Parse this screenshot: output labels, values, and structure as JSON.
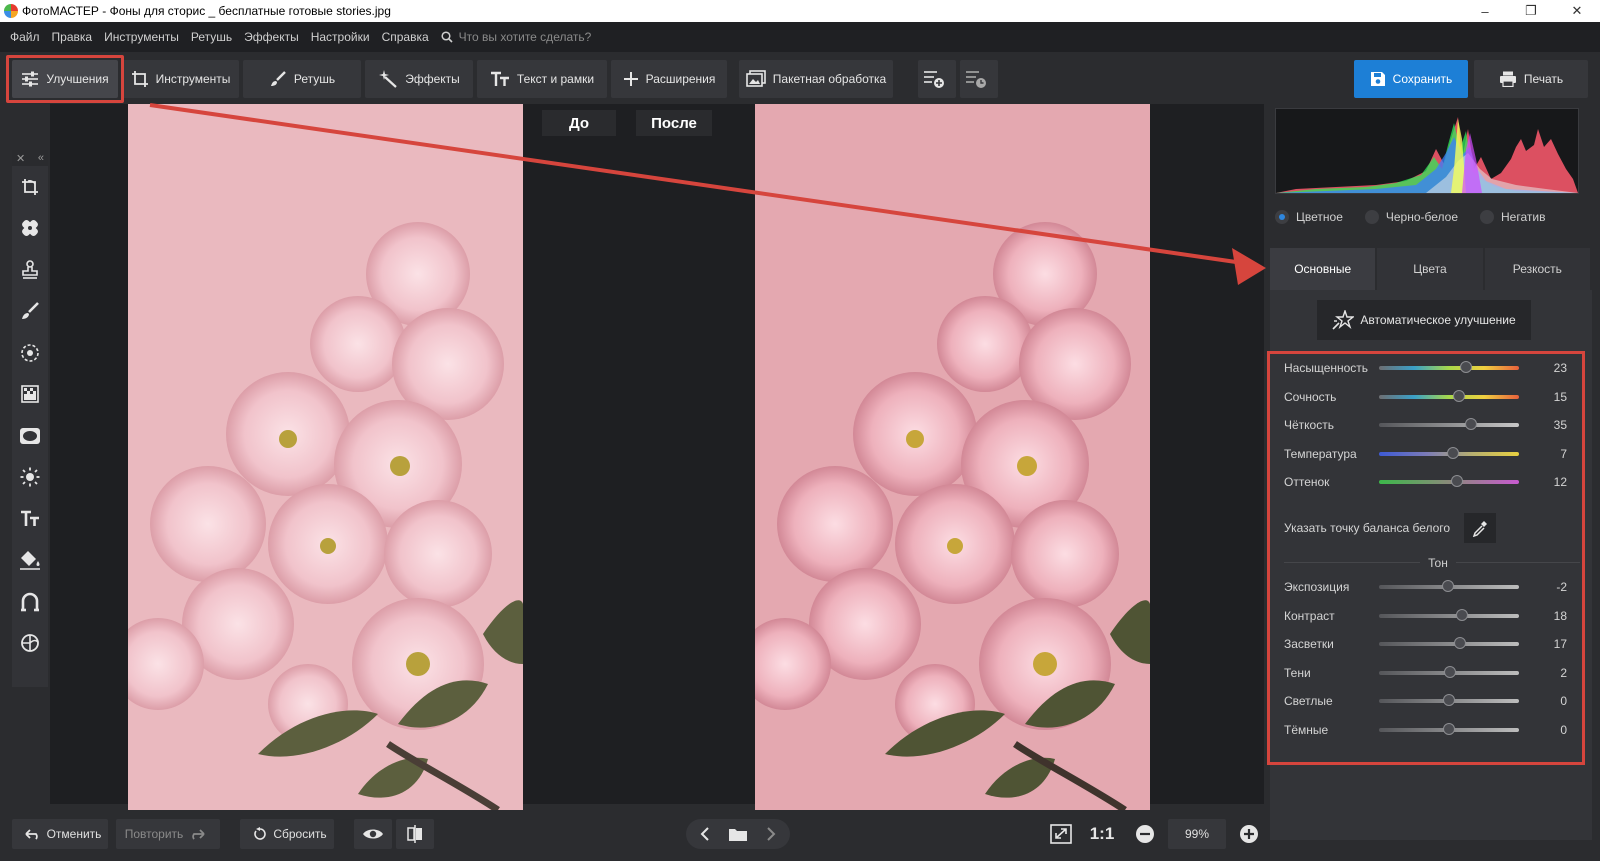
{
  "window": {
    "title": "ФотоМАСТЕР - Фоны для сторис _ бесплатные готовые stories.jpg",
    "minimize": "–",
    "restore": "❐",
    "close": "✕"
  },
  "menu": {
    "items": [
      "Файл",
      "Правка",
      "Инструменты",
      "Ретушь",
      "Эффекты",
      "Настройки",
      "Справка"
    ],
    "search_placeholder": "Что вы хотите сделать?"
  },
  "toolbar": {
    "improvements": "Улучшения",
    "tools": "Инструменты",
    "retouch": "Ретушь",
    "effects": "Эффекты",
    "text_frames": "Текст и рамки",
    "extensions": "Расширения",
    "batch": "Пакетная обработка",
    "save": "Сохранить",
    "print": "Печать"
  },
  "canvas": {
    "before_label": "До",
    "after_label": "После"
  },
  "panel": {
    "modes": [
      {
        "label": "Цветное",
        "selected": true
      },
      {
        "label": "Черно-белое",
        "selected": false
      },
      {
        "label": "Негатив",
        "selected": false
      }
    ],
    "tabs": [
      "Основные",
      "Цвета",
      "Резкость"
    ],
    "active_tab": "Основные",
    "auto_button": "Автоматическое улучшение",
    "color_sliders": [
      {
        "label": "Насыщенность",
        "value": "23",
        "level": 0.62
      },
      {
        "label": "Сочность",
        "value": "15",
        "level": 0.57
      },
      {
        "label": "Чёткость",
        "value": "35",
        "level": 0.66
      },
      {
        "label": "Температура",
        "value": "7",
        "level": 0.53
      },
      {
        "label": "Оттенок",
        "value": "12",
        "level": 0.56
      }
    ],
    "white_balance_label": "Указать точку баланса белого",
    "tone_header": "Тон",
    "tone_sliders": [
      {
        "label": "Экспозиция",
        "value": "-2",
        "level": 0.49
      },
      {
        "label": "Контраст",
        "value": "18",
        "level": 0.59
      },
      {
        "label": "Засветки",
        "value": "17",
        "level": 0.58
      },
      {
        "label": "Тени",
        "value": "2",
        "level": 0.51
      },
      {
        "label": "Светлые",
        "value": "0",
        "level": 0.5
      },
      {
        "label": "Тёмные",
        "value": "0",
        "level": 0.5
      }
    ]
  },
  "bottom": {
    "undo": "Отменить",
    "redo": "Повторить",
    "reset": "Сбросить",
    "one_to_one": "1:1",
    "zoom": "99%"
  },
  "colors": {
    "accent": "#1d7fd6",
    "highlight": "#d6453d",
    "photo_before": "#e9b6bb",
    "photo_after": "#e4a8b0"
  }
}
